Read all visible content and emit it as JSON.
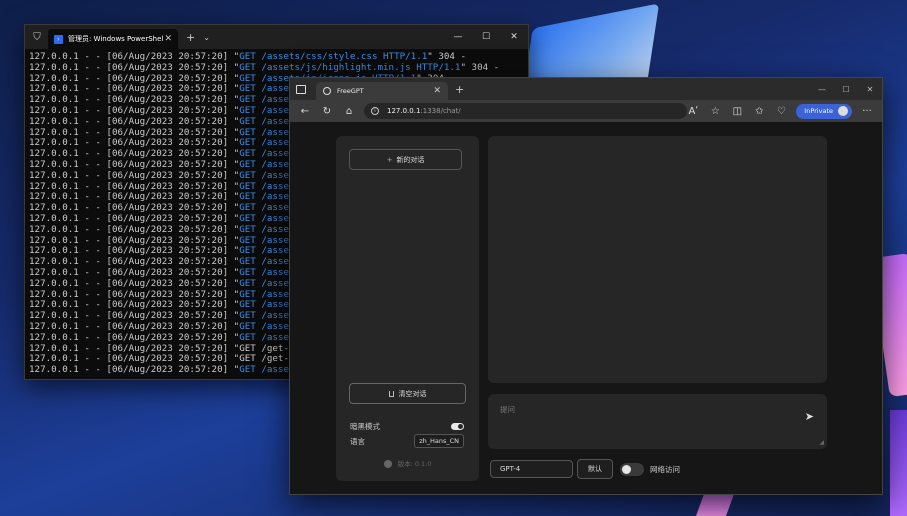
{
  "terminal": {
    "tab_title": "管理员: Windows PowerShell",
    "close": "✕",
    "new_tab": "+",
    "dropdown": "⌄",
    "minimize": "—",
    "maximize": "☐",
    "close_window": "✕",
    "lines": [
      {
        "prefix": "127.0.0.1 - - [06/Aug/2023 20:57:20] \"",
        "method": "GET /assets/css/style.css HTTP/1.1",
        "suffix": "\" 304 -"
      },
      {
        "prefix": "127.0.0.1 - - [06/Aug/2023 20:57:20] \"",
        "method": "GET /assets/js/highlight.min.js HTTP/1.1",
        "suffix": "\" 304 -"
      },
      {
        "prefix": "127.0.0.1 - - [06/Aug/2023 20:57:20] \"",
        "method": "GET /assets/js/icons.js HTTP/1.1",
        "suffix": "\" 304 -"
      },
      {
        "prefix": "127.0.0.1 - - [06/Aug/2023 20:57:20] \"",
        "method": "GET /assets/",
        "suffix": ""
      },
      {
        "prefix": "127.0.0.1 - - [06/Aug/2023 20:57:20] \"",
        "method": "GET /assets/",
        "suffix": ""
      },
      {
        "prefix": "127.0.0.1 - - [06/Aug/2023 20:57:20] \"",
        "method": "GET /assets/",
        "suffix": ""
      },
      {
        "prefix": "127.0.0.1 - - [06/Aug/2023 20:57:20] \"",
        "method": "GET /assets/",
        "suffix": ""
      },
      {
        "prefix": "127.0.0.1 - - [06/Aug/2023 20:57:20] \"",
        "method": "GET /assets/",
        "suffix": ""
      },
      {
        "prefix": "127.0.0.1 - - [06/Aug/2023 20:57:20] \"",
        "method": "GET /assets/",
        "suffix": ""
      },
      {
        "prefix": "127.0.0.1 - - [06/Aug/2023 20:57:20] \"",
        "method": "GET /assets/",
        "suffix": ""
      },
      {
        "prefix": "127.0.0.1 - - [06/Aug/2023 20:57:20] \"",
        "method": "GET /assets/",
        "suffix": ""
      },
      {
        "prefix": "127.0.0.1 - - [06/Aug/2023 20:57:20] \"",
        "method": "GET /assets/",
        "suffix": ""
      },
      {
        "prefix": "127.0.0.1 - - [06/Aug/2023 20:57:20] \"",
        "method": "GET /assets/",
        "suffix": ""
      },
      {
        "prefix": "127.0.0.1 - - [06/Aug/2023 20:57:20] \"",
        "method": "GET /assets/",
        "suffix": ""
      },
      {
        "prefix": "127.0.0.1 - - [06/Aug/2023 20:57:20] \"",
        "method": "GET /assets/",
        "suffix": ""
      },
      {
        "prefix": "127.0.0.1 - - [06/Aug/2023 20:57:20] \"",
        "method": "GET /assets/",
        "suffix": ""
      },
      {
        "prefix": "127.0.0.1 - - [06/Aug/2023 20:57:20] \"",
        "method": "GET /assets/",
        "suffix": ""
      },
      {
        "prefix": "127.0.0.1 - - [06/Aug/2023 20:57:20] \"",
        "method": "GET /assets/",
        "suffix": ""
      },
      {
        "prefix": "127.0.0.1 - - [06/Aug/2023 20:57:20] \"",
        "method": "GET /assets/",
        "suffix": ""
      },
      {
        "prefix": "127.0.0.1 - - [06/Aug/2023 20:57:20] \"",
        "method": "GET /assets/",
        "suffix": ""
      },
      {
        "prefix": "127.0.0.1 - - [06/Aug/2023 20:57:20] \"",
        "method": "GET /assets/",
        "suffix": ""
      },
      {
        "prefix": "127.0.0.1 - - [06/Aug/2023 20:57:20] \"",
        "method": "GET /assets/",
        "suffix": ""
      },
      {
        "prefix": "127.0.0.1 - - [06/Aug/2023 20:57:20] \"",
        "method": "GET /assets/",
        "suffix": ""
      },
      {
        "prefix": "127.0.0.1 - - [06/Aug/2023 20:57:20] \"",
        "method": "GET /assets/",
        "suffix": ""
      },
      {
        "prefix": "127.0.0.1 - - [06/Aug/2023 20:57:20] \"",
        "method": "GET /assets/",
        "suffix": ""
      },
      {
        "prefix": "127.0.0.1 - - [06/Aug/2023 20:57:20] \"",
        "method": "GET /assets/",
        "suffix": ""
      },
      {
        "prefix": "127.0.0.1 - - [06/Aug/2023 20:57:20] \"",
        "method": "GET /assets/",
        "suffix": ""
      },
      {
        "prefix": "127.0.0.1 - - [06/Aug/2023 20:57:20] \"",
        "method": "",
        "suffix": "GET /get-lar"
      },
      {
        "prefix": "127.0.0.1 - - [06/Aug/2023 20:57:20] \"",
        "method": "",
        "suffix": "GET /get-loc"
      },
      {
        "prefix": "127.0.0.1 - - [06/Aug/2023 20:57:20] \"",
        "method": "GET /assets/",
        "suffix": ""
      }
    ]
  },
  "browser": {
    "tab_title": "FreeGPT",
    "tab_close": "✕",
    "new_tab": "+",
    "minimize": "—",
    "maximize": "☐",
    "close_window": "✕",
    "back": "←",
    "refresh": "↻",
    "home": "⌂",
    "url_host": "127.0.0.1",
    "url_path": ":1338/chat/",
    "read_aloud": "Aʹ",
    "favorite": "☆",
    "split": "◫",
    "favorites": "✩",
    "extensions": "♡",
    "inprivate_label": "InPrivate",
    "more": "···"
  },
  "app": {
    "new_chat": "新的对话",
    "clear_chat": "清空对话",
    "dark_mode_label": "暗黑模式",
    "language_label": "语言",
    "language_value": "zh_Hans_CN",
    "version": "版本: 0.1.0",
    "input_placeholder": "提问",
    "model": "GPT-4",
    "jailbreak": "默认",
    "web_access_label": "网络访问",
    "send_icon": "➤",
    "grip": "◢"
  }
}
